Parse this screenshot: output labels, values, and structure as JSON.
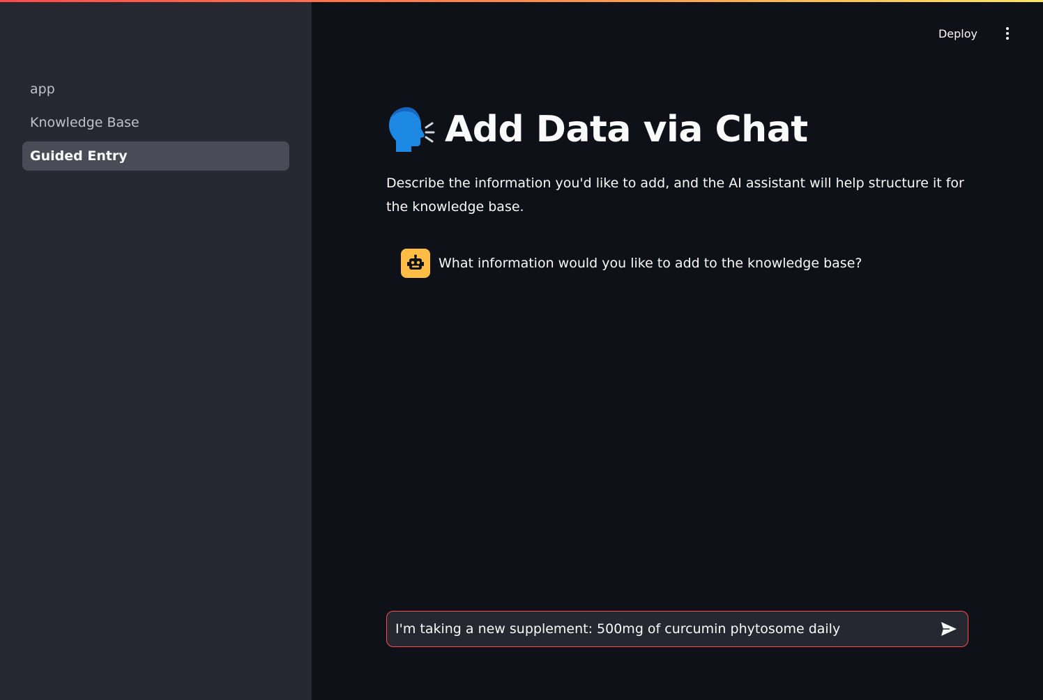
{
  "sidebar": {
    "items": [
      {
        "label": "app",
        "active": false
      },
      {
        "label": "Knowledge Base",
        "active": false
      },
      {
        "label": "Guided Entry",
        "active": true
      }
    ]
  },
  "header": {
    "deploy_label": "Deploy",
    "menu_icon": "vertical-dots-icon"
  },
  "page": {
    "title_emoji_icon": "speaking-head-icon",
    "title": "Add Data via Chat",
    "description": "Describe the information you'd like to add, and the AI assistant will help structure it for the knowledge base."
  },
  "chat": {
    "messages": [
      {
        "role": "assistant",
        "avatar_icon": "robot-icon",
        "text": "What information would you like to add to the knowledge base?"
      }
    ],
    "input_value": "I'm taking a new supplement: 500mg of curcumin phytosome daily",
    "send_icon": "send-arrow-icon"
  },
  "colors": {
    "background": "#0e1117",
    "sidebar": "#262730",
    "active_nav": "#4a4b56",
    "accent": "#ff4b4b",
    "avatar_bg": "#ffbd45"
  }
}
